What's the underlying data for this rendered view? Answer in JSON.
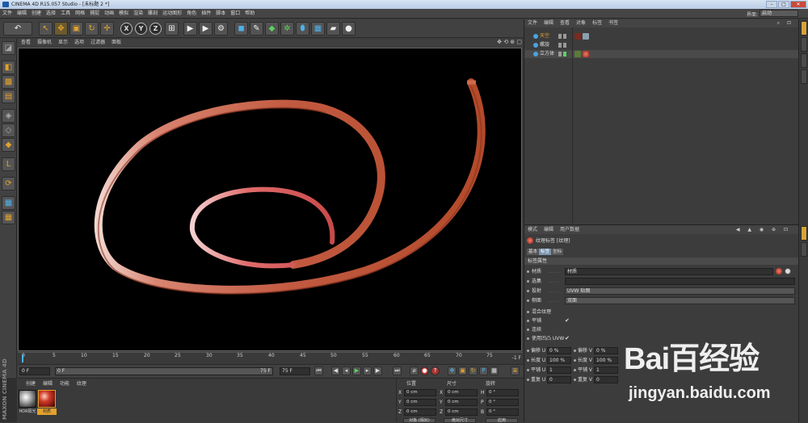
{
  "window": {
    "title": "CINEMA 4D R15.057 Studio - [未标题 2 *]"
  },
  "menubar": [
    "文件",
    "编辑",
    "创建",
    "选择",
    "工具",
    "网格",
    "捕捉",
    "动画",
    "模拟",
    "渲染",
    "雕刻",
    "运动图形",
    "角色",
    "插件",
    "脚本",
    "窗口",
    "帮助"
  ],
  "layout": {
    "label": "界面:",
    "value": "启动"
  },
  "toolbar": {
    "icons": [
      "undo-icon",
      "live-select-icon",
      "move-icon",
      "scale-icon",
      "rotate-icon",
      "add-icon",
      "x-axis-icon",
      "y-axis-icon",
      "z-axis-icon",
      "world-coord-icon",
      "render-view-icon",
      "render-picture-icon",
      "render-settings-icon",
      "cube-icon",
      "pen-icon",
      "subdivision-icon",
      "array-icon",
      "deformer-icon",
      "floor-icon",
      "camera-icon",
      "light-icon"
    ],
    "axis_letters": [
      "X",
      "Y",
      "Z"
    ]
  },
  "viewport": {
    "menu": [
      "查看",
      "摄像机",
      "显示",
      "选项",
      "过滤器",
      "面板"
    ]
  },
  "timeline": {
    "ticks": [
      "0",
      "5",
      "10",
      "15",
      "20",
      "25",
      "30",
      "35",
      "40",
      "45",
      "50",
      "55",
      "60",
      "65",
      "70",
      "75"
    ],
    "end_frame": "-1 F"
  },
  "transport": {
    "start": "0 F",
    "current": "0 F",
    "range_end": "75 F",
    "end": "75 F"
  },
  "material_panel": {
    "tabs": [
      "创建",
      "编辑",
      "功能",
      "纹理"
    ],
    "materials": [
      {
        "name": "HDR阳光",
        "selected": false
      },
      {
        "name": "材质",
        "selected": true
      }
    ]
  },
  "brand": "MAXON CINEMA 4D",
  "coord_panel": {
    "headers": [
      "位置",
      "尺寸",
      "旋转"
    ],
    "rows": [
      {
        "axis": "X",
        "pos": "0 cm",
        "size_axis": "X",
        "size": "0 cm",
        "rot_axis": "H",
        "rot": "0 °"
      },
      {
        "axis": "Y",
        "pos": "0 cm",
        "size_axis": "Y",
        "size": "0 cm",
        "rot_axis": "P",
        "rot": "0 °"
      },
      {
        "axis": "Z",
        "pos": "0 cm",
        "size_axis": "Z",
        "size": "0 cm",
        "rot_axis": "B",
        "rot": "0 °"
      }
    ],
    "buttons": [
      "对象 (相对)",
      "绝对尺寸",
      "应用"
    ]
  },
  "object_manager": {
    "menu": [
      "文件",
      "编辑",
      "查看",
      "对象",
      "标签",
      "书签"
    ],
    "objects": [
      {
        "name": "天空",
        "color": "#4aa3e0"
      },
      {
        "name": "螺旋",
        "color": "#4aa3e0"
      },
      {
        "name": "立方体",
        "color": "#4aa3e0"
      }
    ]
  },
  "attribute_manager": {
    "menu": [
      "模式",
      "编辑",
      "用户数据"
    ],
    "title": "纹理标签 [纹理]",
    "tabs": [
      {
        "label": "基本",
        "selected": false
      },
      {
        "label": "标签",
        "selected": true
      },
      {
        "label": "坐标",
        "selected": false
      }
    ],
    "section": "标签属性",
    "rows": [
      {
        "label": "材质",
        "value": "材质",
        "kind": "box"
      },
      {
        "label": "选集",
        "value": "",
        "kind": "box"
      },
      {
        "label": "投射",
        "value": "UVW 贴图",
        "kind": "select"
      },
      {
        "label": "侧面",
        "value": "双面",
        "kind": "select"
      },
      {
        "label": "混合纹理",
        "value": "",
        "kind": "check"
      },
      {
        "label": "平铺",
        "value": "✔",
        "kind": "check"
      },
      {
        "label": "连续",
        "value": "",
        "kind": "check"
      },
      {
        "label": "使用凹凸 UVW",
        "value": "✔",
        "kind": "check"
      }
    ],
    "uv_left": [
      {
        "label": "偏移 U",
        "value": "0 %"
      },
      {
        "label": "长度 U",
        "value": "100 %"
      },
      {
        "label": "平铺 U",
        "value": "1"
      },
      {
        "label": "重复 U",
        "value": "0"
      }
    ],
    "uv_right": [
      {
        "label": "偏移 V",
        "value": "0 %"
      },
      {
        "label": "长度 V",
        "value": "100 %"
      },
      {
        "label": "平铺 V",
        "value": "1"
      },
      {
        "label": "重复 V",
        "value": "0"
      }
    ]
  },
  "watermark": {
    "logo": "Bai百经验",
    "url": "jingyan.baidu.com"
  },
  "colors": {
    "accent": "#e2a12d",
    "ribbon": "#c8553c",
    "viewport_bg": "#000000"
  }
}
